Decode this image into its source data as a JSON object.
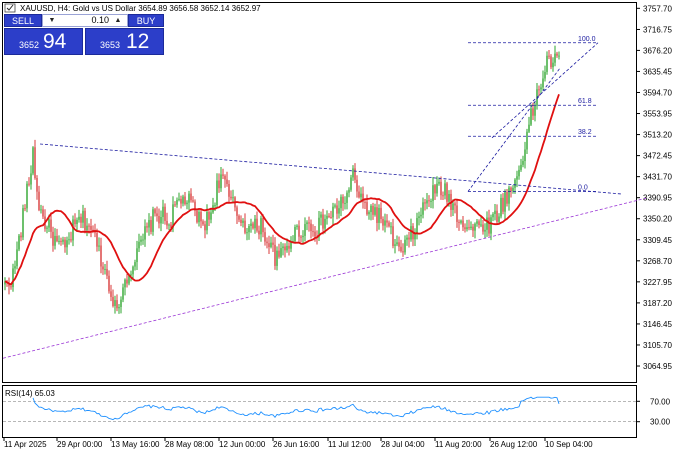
{
  "header": {
    "title": "XAUUSD, H4:  Gold vs US Dollar  3654.89 3656.58 3652.14 3652.97"
  },
  "trade_panel": {
    "sell_label": "SELL",
    "buy_label": "BUY",
    "lot_value": "0.10",
    "sell_price_prefix": "3652",
    "sell_price_big": "94",
    "buy_price_prefix": "3653",
    "buy_price_big": "12",
    "arrow_down_icon": "chevron-down-icon",
    "arrow_up_icon": "chevron-up-icon"
  },
  "colors": {
    "bull": "#2ea62e",
    "bear": "#d83a3a",
    "ma": "#e01010",
    "trendline": "#1a1aa0",
    "support": "#9b36d6",
    "rsi": "#1e90ff",
    "rsi_levels": "#8c8c8c"
  },
  "chart_data": {
    "type": "candlestick",
    "title": "XAUUSD, H4:  Gold vs US Dollar  3654.89 3656.58 3652.14 3652.97",
    "ylim": [
      3034.0,
      3768.0
    ],
    "y_ticks": [
      "3757.70",
      "3716.75",
      "3676.20",
      "3635.45",
      "3594.70",
      "3553.95",
      "3513.20",
      "3472.45",
      "3431.70",
      "3390.95",
      "3350.20",
      "3309.45",
      "3268.70",
      "3227.95",
      "3187.20",
      "3146.45",
      "3105.70",
      "3064.95"
    ],
    "x_ticks": [
      "11 Apr 2025",
      "29 Apr 00:00",
      "13 May 16:00",
      "28 May 08:00",
      "12 Jun 00:00",
      "26 Jun 16:00",
      "11 Jul 12:00",
      "28 Jul 04:00",
      "11 Aug 20:00",
      "26 Aug 12:00",
      "10 Sep 04:00"
    ],
    "price_anchors": [
      [
        0,
        3220
      ],
      [
        4,
        3240
      ],
      [
        8,
        3330
      ],
      [
        10,
        3380
      ],
      [
        12,
        3420
      ],
      [
        14,
        3480
      ],
      [
        16,
        3400
      ],
      [
        18,
        3360
      ],
      [
        22,
        3330
      ],
      [
        26,
        3300
      ],
      [
        30,
        3290
      ],
      [
        34,
        3330
      ],
      [
        38,
        3350
      ],
      [
        42,
        3340
      ],
      [
        46,
        3300
      ],
      [
        50,
        3250
      ],
      [
        54,
        3200
      ],
      [
        56,
        3160
      ],
      [
        58,
        3210
      ],
      [
        62,
        3250
      ],
      [
        66,
        3280
      ],
      [
        70,
        3320
      ],
      [
        74,
        3350
      ],
      [
        78,
        3360
      ],
      [
        82,
        3340
      ],
      [
        86,
        3380
      ],
      [
        90,
        3390
      ],
      [
        94,
        3370
      ],
      [
        98,
        3340
      ],
      [
        102,
        3350
      ],
      [
        106,
        3410
      ],
      [
        108,
        3440
      ],
      [
        112,
        3390
      ],
      [
        116,
        3360
      ],
      [
        120,
        3340
      ],
      [
        124,
        3330
      ],
      [
        128,
        3340
      ],
      [
        132,
        3300
      ],
      [
        136,
        3270
      ],
      [
        140,
        3290
      ],
      [
        144,
        3320
      ],
      [
        148,
        3330
      ],
      [
        152,
        3340
      ],
      [
        156,
        3330
      ],
      [
        160,
        3350
      ],
      [
        164,
        3360
      ],
      [
        168,
        3380
      ],
      [
        172,
        3400
      ],
      [
        174,
        3440
      ],
      [
        178,
        3380
      ],
      [
        182,
        3370
      ],
      [
        186,
        3360
      ],
      [
        190,
        3340
      ],
      [
        194,
        3310
      ],
      [
        198,
        3280
      ],
      [
        202,
        3310
      ],
      [
        206,
        3340
      ],
      [
        210,
        3380
      ],
      [
        214,
        3400
      ],
      [
        218,
        3410
      ],
      [
        222,
        3390
      ],
      [
        226,
        3360
      ],
      [
        230,
        3340
      ],
      [
        234,
        3330
      ],
      [
        238,
        3340
      ],
      [
        242,
        3340
      ],
      [
        246,
        3360
      ],
      [
        250,
        3390
      ],
      [
        254,
        3410
      ],
      [
        258,
        3460
      ],
      [
        262,
        3530
      ],
      [
        266,
        3590
      ],
      [
        270,
        3640
      ],
      [
        272,
        3660
      ],
      [
        274,
        3655
      ],
      [
        278,
        3652
      ]
    ],
    "ma_period": 20,
    "fibonacci": {
      "levels": [
        {
          "label": "100.0",
          "value": 3691
        },
        {
          "label": "61.8",
          "value": 3570
        },
        {
          "label": "38.2",
          "value": 3510
        },
        {
          "label": "0.0",
          "value": 3403
        }
      ]
    },
    "trendlines": [
      {
        "name": "descending-resistance",
        "points": [
          [
            "14 Apr",
            3495
          ],
          [
            "11 Sep",
            3398
          ]
        ]
      },
      {
        "name": "ascending-support",
        "points": [
          [
            "11 Apr",
            3080
          ],
          [
            "11 Sep",
            3390
          ]
        ]
      }
    ],
    "channel": {
      "lower_from": 3403,
      "lower_to": 3642,
      "upper_from": 3507,
      "upper_to": 3691
    },
    "rsi": {
      "label": "RSI(14) 65.03",
      "period": 14,
      "value": 65.03,
      "ylim": [
        0,
        100
      ],
      "levels": [
        70,
        30
      ],
      "level_labels": [
        "70.00",
        "30.00"
      ]
    }
  }
}
